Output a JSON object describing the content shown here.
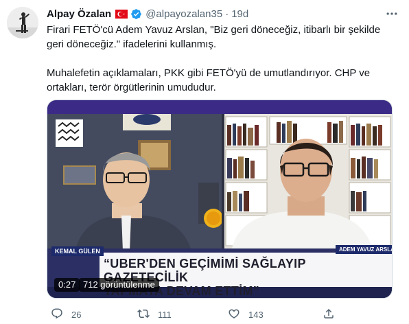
{
  "tweet": {
    "author": {
      "display_name": "Alpay Özalan",
      "handle": "@alpayozalan35",
      "flag_icon": "turkey-flag-icon",
      "verified_icon": "verified-badge-icon"
    },
    "separator": "·",
    "time": "19d",
    "more_icon": "more-options-icon",
    "text": {
      "paragraph_1": "Firari FETÖ'cü Adem Yavuz Arslan, \"Biz geri döneceğiz, itibarlı bir şekilde geri döneceğiz.\" ifadelerini kullanmış.",
      "paragraph_2": "Muhalefetin açıklamaları, PKK gibi FETÖ'yü de umutlandırıyor. CHP ve ortakları, terör örgütlerinin umududur."
    },
    "media": {
      "left_name": "KEMAL GÜLEN",
      "right_name": "ADEM YAVUZ ARSLA",
      "caption_line_1": "“UBER'DEN GEÇİMİMİ SAĞLAYIP GAZETECİLİK",
      "caption_line_2": "YAPMAYA DEVAM ETTİM”",
      "timecode": "0:27",
      "views": "712 görüntülenme"
    },
    "actions": {
      "reply_count": "26",
      "retweet_count": "111",
      "like_count": "143"
    }
  }
}
